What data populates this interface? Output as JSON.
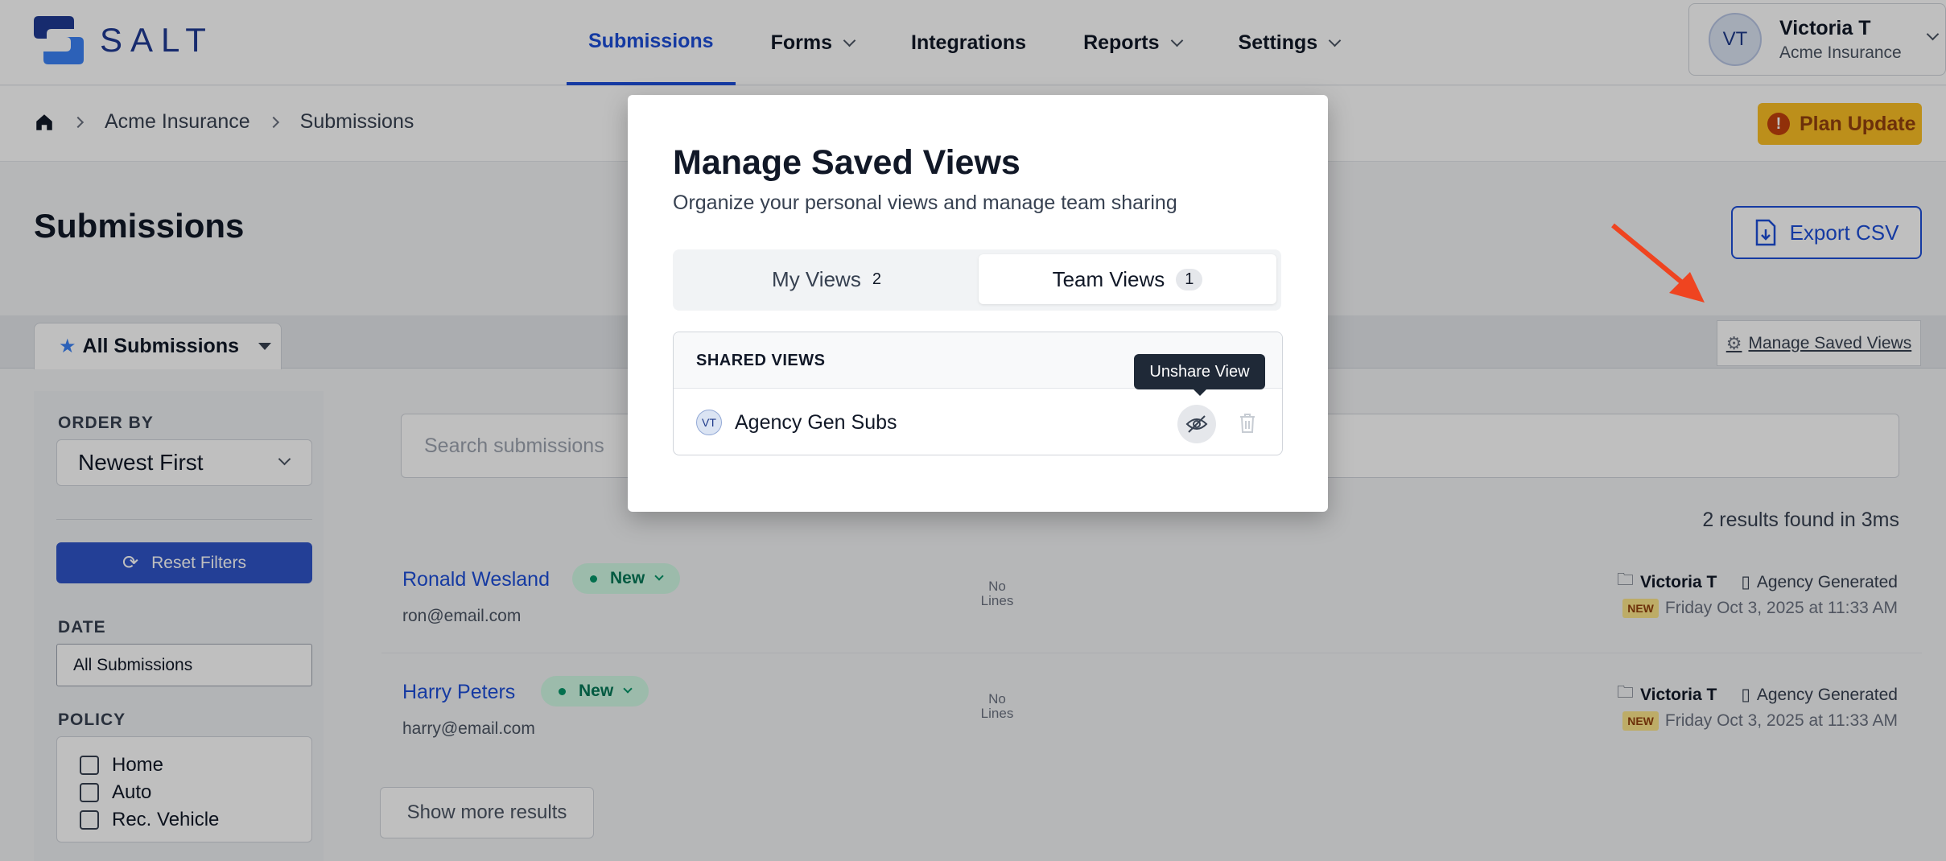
{
  "brand": {
    "name": "SALT",
    "accent": "#1d4ed8"
  },
  "nav": {
    "items": [
      {
        "label": "Submissions",
        "active": true,
        "dropdown": false
      },
      {
        "label": "Forms",
        "dropdown": true
      },
      {
        "label": "Integrations",
        "dropdown": false
      },
      {
        "label": "Reports",
        "dropdown": true
      },
      {
        "label": "Settings",
        "dropdown": true
      }
    ],
    "user": {
      "initials": "VT",
      "name": "Victoria T",
      "org": "Acme Insurance"
    }
  },
  "breadcrumb": {
    "home_icon": "home-icon",
    "items": [
      "Acme Insurance",
      "Submissions"
    ]
  },
  "plan_update": {
    "label": "Plan Update",
    "icon": "!"
  },
  "page": {
    "title": "Submissions",
    "export_label": "Export CSV",
    "active_view": "All Submissions",
    "manage_link": "Manage Saved Views"
  },
  "filters": {
    "order_by_label": "ORDER BY",
    "order_by_value": "Newest First",
    "reset_label": "Reset Filters",
    "date_label": "DATE",
    "date_value": "All Submissions",
    "policy_label": "POLICY",
    "policy_options": [
      "Home",
      "Auto",
      "Rec. Vehicle"
    ]
  },
  "list": {
    "search_placeholder": "Search submissions",
    "results_text": "2 results found in 3ms",
    "rows": [
      {
        "name": "Ronald Wesland",
        "email": "ron@email.com",
        "status": "New",
        "lines": [
          "No",
          "Lines"
        ],
        "owner": "Victoria T",
        "source": "Agency Generated",
        "tag": "NEW",
        "date": "Friday Oct 3, 2025 at 11:33 AM"
      },
      {
        "name": "Harry Peters",
        "email": "harry@email.com",
        "status": "New",
        "lines": [
          "No",
          "Lines"
        ],
        "owner": "Victoria T",
        "source": "Agency Generated",
        "tag": "NEW",
        "date": "Friday Oct 3, 2025 at 11:33 AM"
      }
    ],
    "show_more": "Show more results"
  },
  "modal": {
    "title": "Manage Saved Views",
    "subtitle": "Organize your personal views and manage team sharing",
    "tabs": [
      {
        "label": "My Views",
        "count": "2"
      },
      {
        "label": "Team Views",
        "count": "1",
        "active": true
      }
    ],
    "section_header": "SHARED VIEWS",
    "views": [
      {
        "initials": "VT",
        "name": "Agency Gen Subs"
      }
    ],
    "tooltip": "Unshare View"
  }
}
